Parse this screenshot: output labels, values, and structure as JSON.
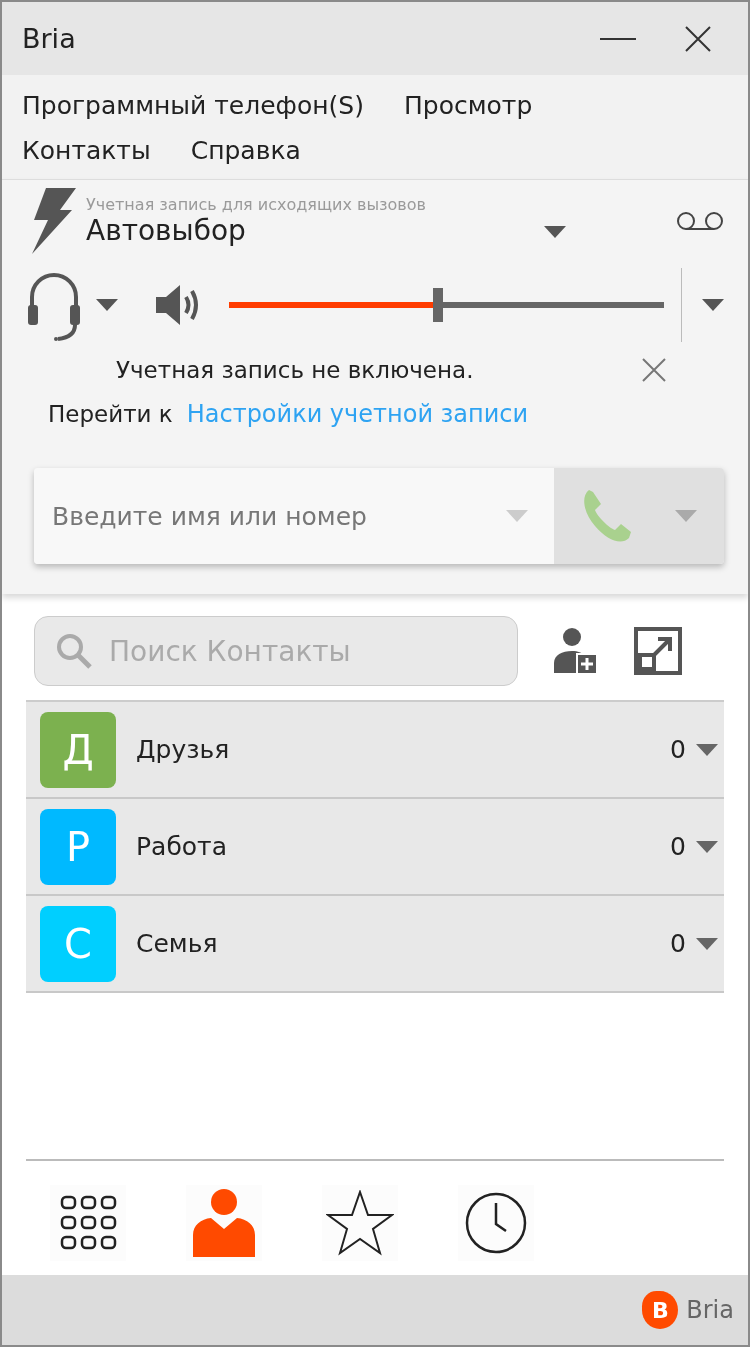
{
  "window": {
    "title": "Bria"
  },
  "menu": [
    "Программный телефон(S)",
    "Просмотр",
    "Контакты",
    "Справка"
  ],
  "account": {
    "caption": "Учетная запись для исходящих вызовов",
    "value": "Автовыбор"
  },
  "audio": {
    "level": 0.48
  },
  "notice": {
    "message": "Учетная запись не включена.",
    "prefix": "Перейти к",
    "link": "Настройки учетной записи"
  },
  "dial": {
    "placeholder": "Введите имя или номер"
  },
  "search": {
    "placeholder": "Поиск Контакты"
  },
  "groups": [
    {
      "letter": "Д",
      "name": "Друзья",
      "count": "0",
      "color": "#7cb14f"
    },
    {
      "letter": "Р",
      "name": "Работа",
      "count": "0",
      "color": "#00b9ff"
    },
    {
      "letter": "С",
      "name": "Семья",
      "count": "0",
      "color": "#00cfff"
    }
  ],
  "tabs": [
    {
      "kind": "dialpad",
      "selected": false
    },
    {
      "kind": "contacts",
      "selected": true
    },
    {
      "kind": "favorites",
      "selected": false
    },
    {
      "kind": "history",
      "selected": false
    }
  ],
  "footer": {
    "logo_letter": "B",
    "brand": "Bria"
  }
}
